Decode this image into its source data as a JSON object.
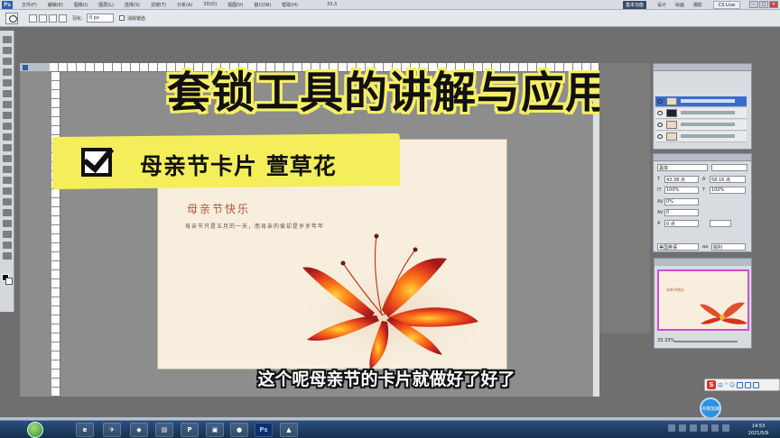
{
  "menubar": {
    "items": [
      "文件(F)",
      "编辑(E)",
      "图像(I)",
      "图层(L)",
      "选择(S)",
      "滤镜(T)",
      "分析(A)",
      "3D(D)",
      "视图(V)",
      "窗口(W)",
      "帮助(H)"
    ],
    "zoom": "33.3",
    "workspace": "基本功能",
    "right_items": [
      "设计",
      "绘画",
      "摄影"
    ],
    "cs_live": "CS Live"
  },
  "options": {
    "feather_label": "羽化:",
    "feather_value": "0 px",
    "antialias_label": "消除锯齿"
  },
  "overlay": {
    "video_title": "套锁工具的讲解与应用",
    "banner_text": "母亲节卡片 萱草花",
    "subtitle": "这个呢母亲节的卡片就做好了好了"
  },
  "canvas": {
    "title": "母亲节快乐",
    "subtitle": "母亲节只是五月的一天，而母亲的爱却是岁岁年年",
    "background_color": "#f8eedd",
    "title_color": "#b0553a"
  },
  "character_panel": {
    "font": "黑体",
    "size": "43.38 点",
    "leading": "58.16 点",
    "scale_v": "100%",
    "scale_h": "100%",
    "tracking": "0%",
    "kerning": "0",
    "baseline": "0 点",
    "language": "美国英语",
    "aa": "aa",
    "aa_mode": "锐利"
  },
  "navigator": {
    "zoom": "33.33%",
    "mini_title": "母亲节快乐"
  },
  "float_button": {
    "label": "点我加速"
  },
  "taskbar": {
    "time": "14:53",
    "date": "2021/5/9"
  }
}
